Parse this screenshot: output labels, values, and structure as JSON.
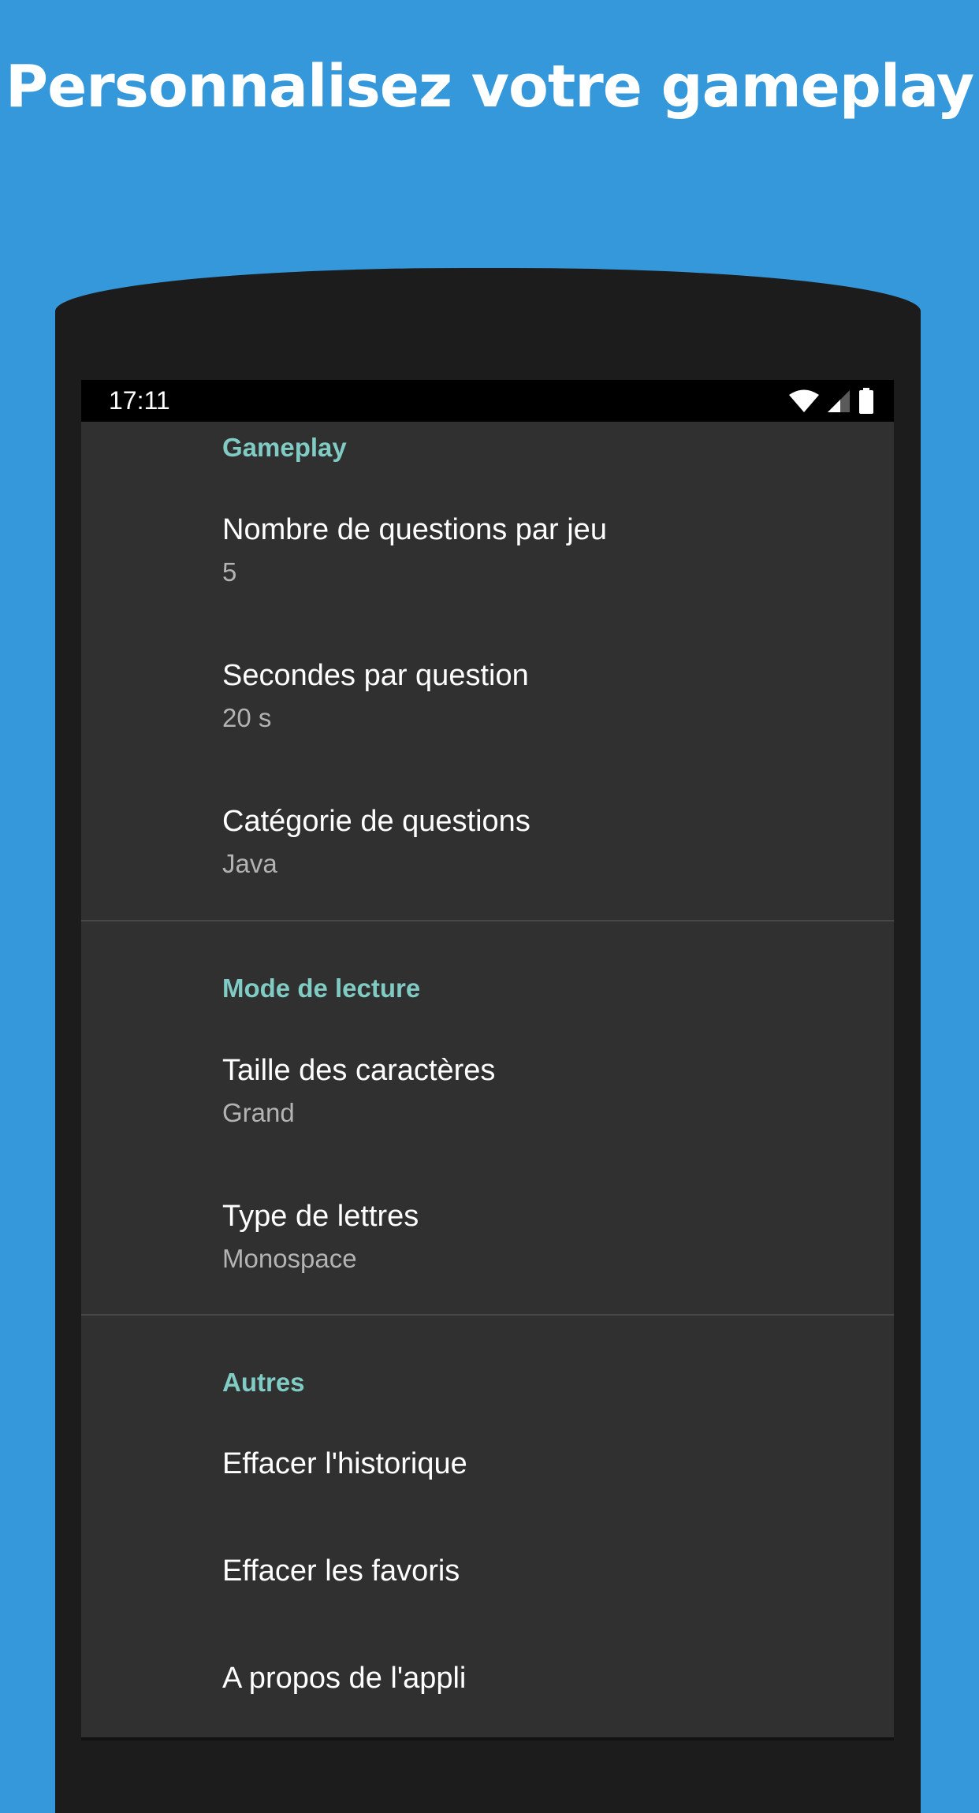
{
  "promo": {
    "title": "Personnalisez votre gameplay"
  },
  "status_bar": {
    "time": "17:11",
    "icons": [
      "wifi-icon",
      "cell-signal-icon",
      "battery-icon"
    ]
  },
  "sections": [
    {
      "header": "Gameplay",
      "items": [
        {
          "title": "Nombre de questions par jeu",
          "summary": "5"
        },
        {
          "title": "Secondes par question",
          "summary": "20 s"
        },
        {
          "title": "Catégorie de questions",
          "summary": "Java"
        }
      ]
    },
    {
      "header": "Mode de lecture",
      "items": [
        {
          "title": "Taille des caractères",
          "summary": "Grand"
        },
        {
          "title": "Type de lettres",
          "summary": "Monospace"
        }
      ]
    },
    {
      "header": "Autres",
      "items": [
        {
          "title": "Effacer l'historique"
        },
        {
          "title": "Effacer les favoris"
        },
        {
          "title": "A propos de l'appli"
        }
      ]
    }
  ],
  "colors": {
    "background": "#3598db",
    "phone_body": "#1c1c1c",
    "screen": "#303030",
    "section_header": "#80cbc4",
    "title_text": "#ffffff",
    "summary_text": "#b3b3b3"
  }
}
